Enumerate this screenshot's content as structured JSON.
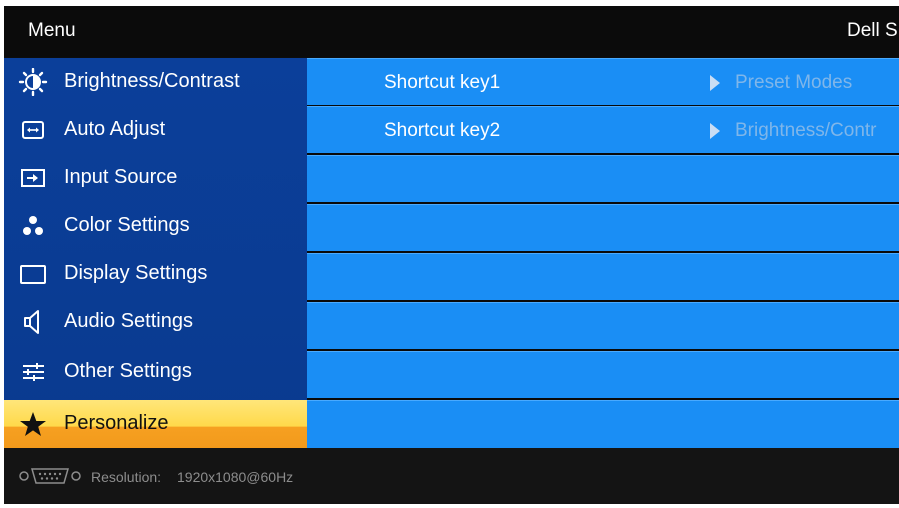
{
  "header": {
    "title": "Menu",
    "brand": "Dell S"
  },
  "menu": {
    "items": [
      {
        "label": "Brightness/Contrast",
        "icon": "brightness-icon"
      },
      {
        "label": "Auto Adjust",
        "icon": "auto-adjust-icon"
      },
      {
        "label": "Input Source",
        "icon": "input-source-icon"
      },
      {
        "label": "Color Settings",
        "icon": "color-settings-icon"
      },
      {
        "label": "Display Settings",
        "icon": "display-settings-icon"
      },
      {
        "label": "Audio Settings",
        "icon": "speaker-icon"
      },
      {
        "label": "Other Settings",
        "icon": "sliders-icon"
      },
      {
        "label": "Personalize",
        "icon": "star-icon",
        "selected": true
      }
    ]
  },
  "content": {
    "rows": [
      {
        "key": "Shortcut key1",
        "value": "Preset Modes"
      },
      {
        "key": "Shortcut key2",
        "value": "Brightness/Contr"
      },
      {
        "key": "",
        "value": ""
      },
      {
        "key": "",
        "value": ""
      },
      {
        "key": "",
        "value": ""
      },
      {
        "key": "",
        "value": ""
      },
      {
        "key": "",
        "value": ""
      },
      {
        "key": "",
        "value": ""
      }
    ]
  },
  "footer": {
    "connector_icon": "vga-connector-icon",
    "resolution_label": "Resolution:",
    "resolution_value": "1920x1080@60Hz"
  },
  "colors": {
    "sidebar": "#0b3f9a",
    "row": "#1a8ef5",
    "selected_top": "#ffe67a",
    "selected_bottom": "#f39a1b",
    "value_text": "#7fb6ea"
  }
}
